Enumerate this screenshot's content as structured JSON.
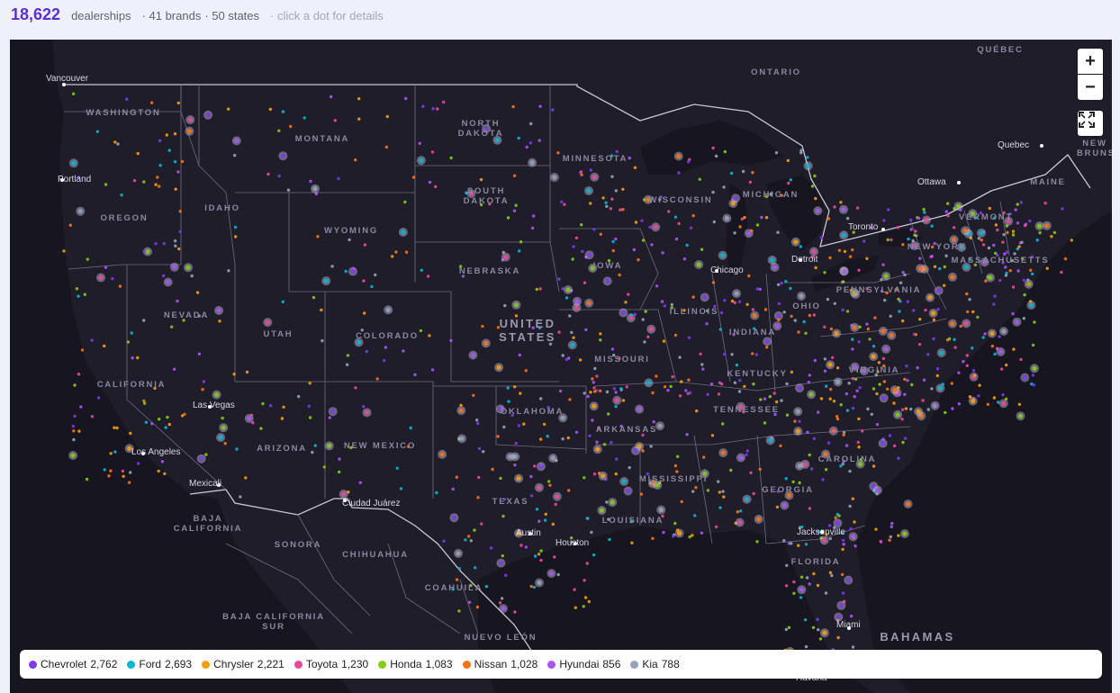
{
  "header": {
    "count": "18,622",
    "count_label": "dealerships",
    "brands": "· 41 brands",
    "states": "· 50 states",
    "hint": "· click a dot for details"
  },
  "controls": {
    "zoom_in": "+",
    "zoom_out": "−"
  },
  "colors": {
    "accent": "#5b2fd6",
    "map_background": "#1f1d2a"
  },
  "legend": [
    {
      "brand": "Chevrolet",
      "count": "2,762",
      "color": "#7c3aed"
    },
    {
      "brand": "Ford",
      "count": "2,693",
      "color": "#06b6d4"
    },
    {
      "brand": "Chrysler",
      "count": "2,221",
      "color": "#f59e0b"
    },
    {
      "brand": "Toyota",
      "count": "1,230",
      "color": "#ec4899"
    },
    {
      "brand": "Honda",
      "count": "1,083",
      "color": "#84cc16"
    },
    {
      "brand": "Nissan",
      "count": "1,028",
      "color": "#f97316"
    },
    {
      "brand": "Hyundai",
      "count": "856",
      "color": "#a855f7"
    },
    {
      "brand": "Kia",
      "count": "788",
      "color": "#94a3b8"
    }
  ],
  "map_labels": {
    "states": [
      "WASHINGTON",
      "MONTANA",
      "NORTH DAKOTA",
      "MINNESOTA",
      "OREGON",
      "IDAHO",
      "SOUTH DAKOTA",
      "WYOMING",
      "WISCONSIN",
      "MICHIGAN",
      "NEBRASKA",
      "IOWA",
      "NEVADA",
      "UTAH",
      "COLORADO",
      "CALIFORNIA",
      "MISSOURI",
      "KENTUCKY",
      "OKLAHOMA",
      "ARIZONA",
      "NEW MEXICO",
      "ARKANSAS",
      "TENNESSEE",
      "TEXAS",
      "MISSISSIPPI",
      "LOUISIANA",
      "GEORGIA",
      "FLORIDA",
      "VIRGINIA",
      "OHIO",
      "PENNSYLVANIA",
      "NEW YORK",
      "VERMONT",
      "MAINE",
      "MASSACHUSETTS",
      "CAROLINA",
      "ILLINOIS",
      "INDIANA"
    ],
    "regions": [
      "ONTARIO",
      "QUÉBEC",
      "BAJA CALIFORNIA",
      "BAJA CALIFORNIA SUR",
      "SONORA",
      "CHIHUAHUA",
      "COAHUILA",
      "NUEVO LEÓN",
      "NEW BRUNSWICK"
    ],
    "countries": [
      "UNITED STATES",
      "BAHAMAS"
    ],
    "cities": [
      "Vancouver",
      "Portland",
      "Las Vegas",
      "Los Angeles",
      "Mexicali",
      "Ciudad Juárez",
      "Ottawa",
      "Quebec",
      "Toronto",
      "Chicago",
      "Detroit",
      "Austin",
      "Houston",
      "Jacksonville",
      "Miami",
      "Havana"
    ]
  }
}
